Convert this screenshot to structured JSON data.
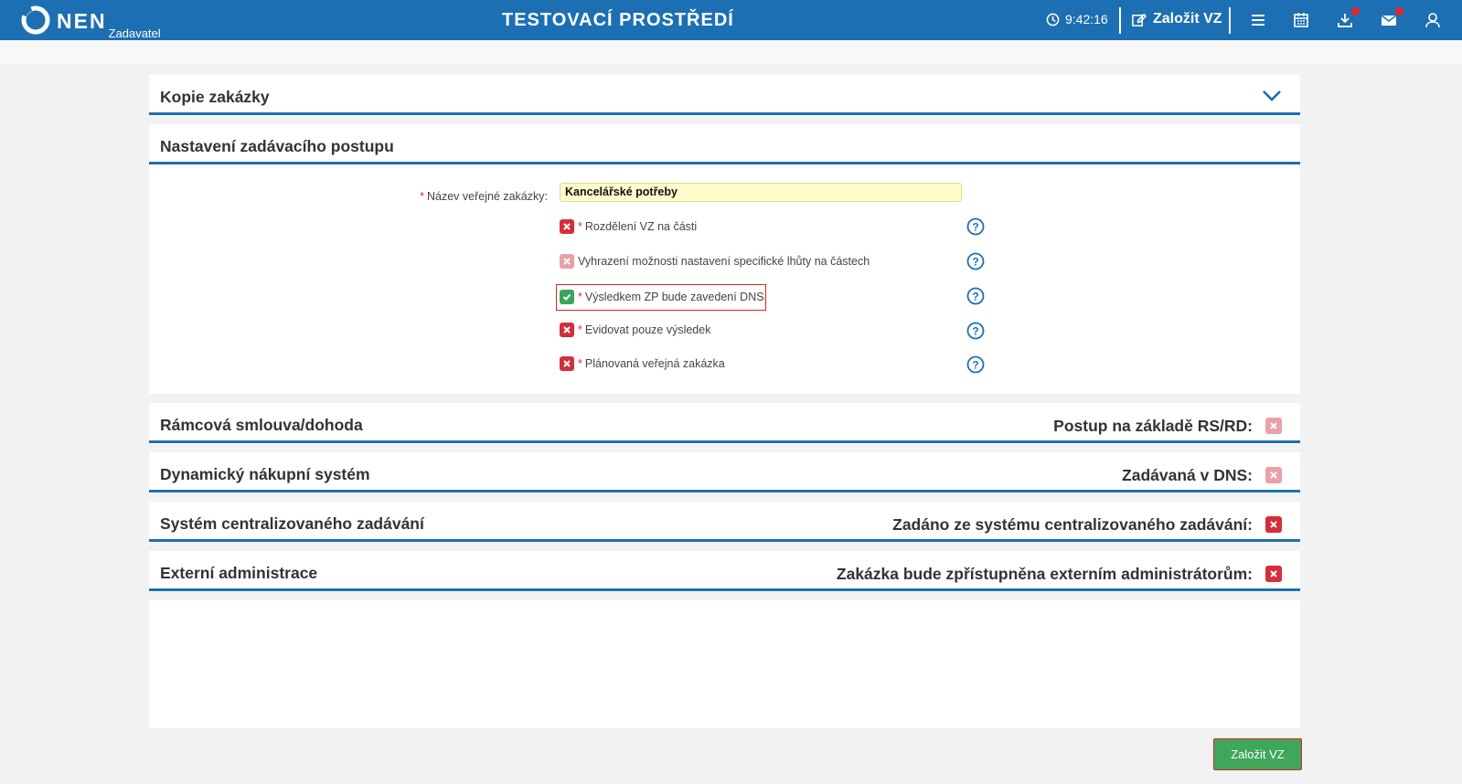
{
  "header": {
    "brand": "NEN",
    "brand_sub": "Zadavatel",
    "environment": "TESTOVACÍ PROSTŘEDÍ",
    "time": "9:42:16",
    "create_label": "Založit VZ",
    "icons": [
      "clock-icon",
      "edit-icon",
      "menu-icon",
      "calendar-icon",
      "download-icon",
      "mail-icon",
      "user-icon"
    ],
    "accent": "#1c6fb2"
  },
  "sections": {
    "copy": {
      "title": "Kopie zakázky"
    },
    "settings": {
      "title": "Nastavení zadávacího postupu",
      "name_label": "Název veřejné zakázky:",
      "name_value": "Kancelářské potřeby",
      "options": [
        {
          "label": "Rozdělení VZ na části",
          "required": true,
          "state": "no"
        },
        {
          "label": "Vyhrazení možnosti nastavení specifické lhůty na částech",
          "required": false,
          "state": "no-disabled"
        },
        {
          "label": "Výsledkem ZP bude zavedení DNS",
          "required": true,
          "state": "yes"
        },
        {
          "label": "Evidovat pouze výsledek",
          "required": true,
          "state": "no"
        },
        {
          "label": "Plánovaná veřejná zakázka",
          "required": true,
          "state": "no"
        }
      ]
    },
    "framework": {
      "title": "Rámcová smlouva/dohoda",
      "right_label": "Postup na základě RS/RD:",
      "state": "no-disabled"
    },
    "dns": {
      "title": "Dynamický nákupní systém",
      "right_label": "Zadávaná v DNS:",
      "state": "no-disabled"
    },
    "central": {
      "title": "Systém centralizovaného zadávání",
      "right_label": "Zadáno ze systému centralizovaného zadávání:",
      "state": "no"
    },
    "external": {
      "title": "Externí administrace",
      "right_label": "Zakázka bude zpřístupněna externím administrátorům:",
      "state": "no"
    }
  },
  "footer": {
    "submit_label": "Založit VZ"
  },
  "colors": {
    "no": "#d32f3a",
    "no_disabled": "#e9a1a6",
    "yes": "#3aa65a",
    "submit": "#3fa75a"
  }
}
